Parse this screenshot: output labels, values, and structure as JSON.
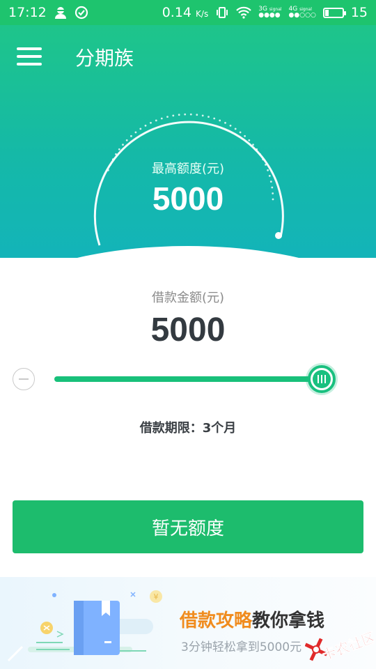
{
  "status_bar": {
    "time": "17:12",
    "speed": "0.14",
    "speed_unit": "K/s",
    "net_3g": "3G",
    "net_4g": "4G",
    "signal_label": "signal",
    "battery": "15"
  },
  "header": {
    "title": "分期族"
  },
  "gauge": {
    "label": "最高额度(元)",
    "value": "5000",
    "level": 1.0
  },
  "loan": {
    "label": "借款金额(元)",
    "value": "5000",
    "slider_fraction": 1.0,
    "term": "借款期限：3个月"
  },
  "cta": {
    "label": "暂无额度"
  },
  "banner": {
    "title_highlight": "借款攻略",
    "title_rest": "教你拿钱",
    "subtitle": "3分钟轻松拿到5000元",
    "coin": "¥"
  },
  "watermark": {
    "text": "卡农社区"
  },
  "colors": {
    "status_bar": "#1ec46e",
    "hero_top": "#1ec58a",
    "hero_bottom": "#13b4b9",
    "accent": "#1dbc6d",
    "highlight": "#f08c1e"
  }
}
